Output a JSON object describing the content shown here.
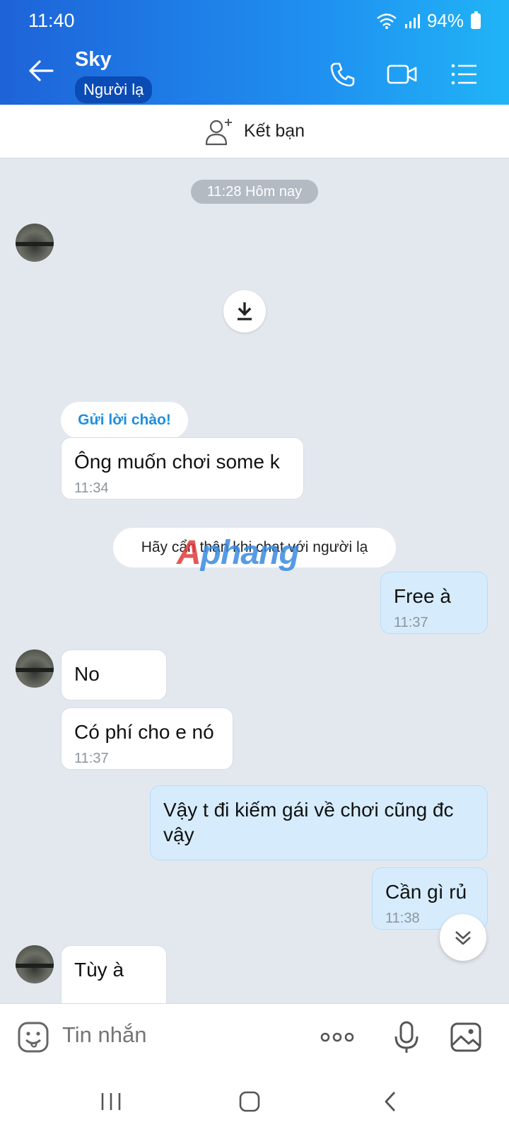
{
  "status": {
    "time": "11:40",
    "battery": "94%"
  },
  "header": {
    "name": "Sky",
    "badge": "Người lạ"
  },
  "add_friend": {
    "label": "Kết bạn"
  },
  "chat": {
    "date_pill": "11:28 Hôm nay",
    "greet": "Gửi lời chào!",
    "warning": "Hãy cẩn thận khi chat với người lạ",
    "watermark": "Aphang",
    "messages": [
      {
        "text": "Ông muốn chơi some k",
        "time": "11:34"
      },
      {
        "text": "Free à",
        "time": "11:37"
      },
      {
        "text": "No",
        "time": ""
      },
      {
        "text": "Có phí cho e nó",
        "time": "11:37"
      },
      {
        "text": "Vậy t đi kiếm gái về chơi cũng đc vậy",
        "time": ""
      },
      {
        "text": "Cần gì rủ",
        "time": "11:38"
      },
      {
        "text": "Tùy à",
        "time": ""
      }
    ]
  },
  "input": {
    "placeholder": "Tin nhắn"
  },
  "icons": {
    "back": "arrow-left-icon",
    "call": "phone-icon",
    "video": "video-camera-icon",
    "menu": "list-menu-icon",
    "add_friend": "add-user-icon",
    "download": "download-icon",
    "sticker": "sticker-icon",
    "more": "more-dots-icon",
    "mic": "microphone-icon",
    "image": "image-icon",
    "scroll": "double-chevron-down-icon"
  },
  "colors": {
    "header_start": "#1e63d8",
    "header_end": "#20b4f6",
    "outgoing": "#d6ecfc",
    "incoming": "#ffffff",
    "background": "#e3e8ef"
  }
}
